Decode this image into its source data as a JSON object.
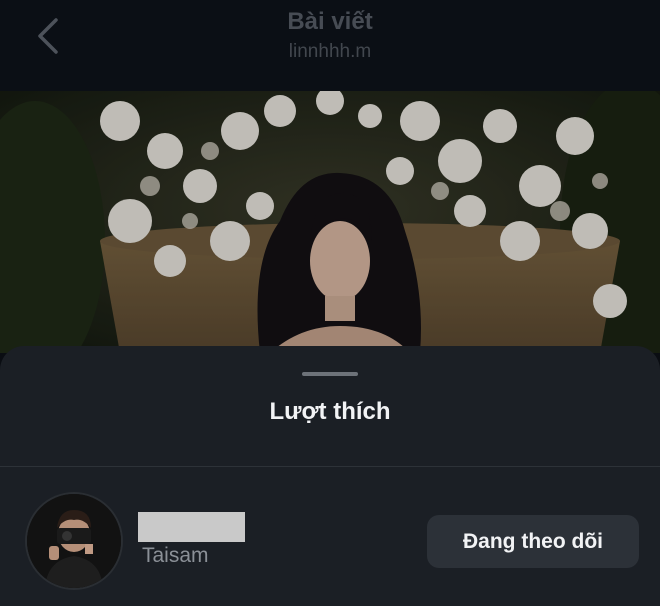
{
  "header": {
    "title": "Bài viết",
    "subtitle": "linnhhh.m",
    "back_icon": "chevron-left-icon"
  },
  "post_image": {
    "description_icon": "photo"
  },
  "likes_sheet": {
    "title": "Lượt thích",
    "users": [
      {
        "display_name": "",
        "username": "Taisam",
        "follow_label": "Đang theo dõi"
      }
    ]
  },
  "colors": {
    "sheet_bg": "#1b1f25",
    "button_bg": "#2c3138",
    "header_text": "#474c54"
  }
}
